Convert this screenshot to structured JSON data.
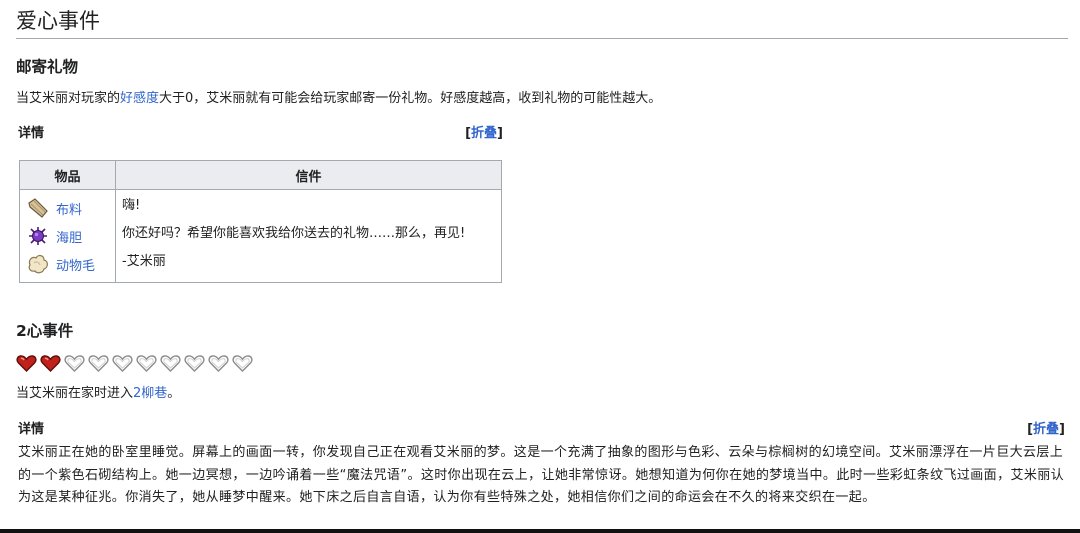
{
  "section": {
    "title": "爱心事件"
  },
  "mail_gift": {
    "title": "邮寄礼物",
    "intro_prefix": "当艾米丽对玩家的",
    "intro_link": "好感度",
    "intro_suffix": "大于0，艾米丽就有可能会给玩家邮寄一份礼物。好感度越高，收到礼物的可能性越大。",
    "details_label": "详情",
    "toggle_open": "[",
    "toggle_link": "折叠",
    "toggle_close": "]",
    "table": {
      "col_items": "物品",
      "col_letter": "信件",
      "items": [
        {
          "icon": "cloth-icon",
          "label": "布料"
        },
        {
          "icon": "sea-urchin-icon",
          "label": "海胆"
        },
        {
          "icon": "wool-icon",
          "label": "动物毛"
        }
      ],
      "letter": {
        "line1": "嗨!",
        "line2": "你还好吗？希望你能喜欢我给你送去的礼物……那么，再见!",
        "line3": "-艾米丽"
      }
    }
  },
  "two_heart": {
    "title": "2心事件",
    "hearts_total": 10,
    "hearts_filled": 2,
    "filled_color": "#c0221b",
    "empty_color": "#ffffff",
    "intro_prefix": "当艾米丽在家时进入",
    "intro_link": "2柳巷",
    "intro_suffix": "。",
    "details_label": "详情",
    "toggle_open": "[",
    "toggle_link": "折叠",
    "toggle_close": "]",
    "description": "艾米丽正在她的卧室里睡觉。屏幕上的画面一转，你发现自己正在观看艾米丽的梦。这是一个充满了抽象的图形与色彩、云朵与棕榈树的幻境空间。艾米丽漂浮在一片巨大云层上的一个紫色石砌结构上。她一边冥想，一边吟诵着一些“魔法咒语”。这时你出现在云上，让她非常惊讶。她想知道为何你在她的梦境当中。此时一些彩虹条纹飞过画面，艾米丽认为这是某种征兆。你消失了，她从睡梦中醒来。她下床之后自言自语，认为你有些特殊之处，她相信你们之间的命运会在不久的将来交织在一起。"
  }
}
